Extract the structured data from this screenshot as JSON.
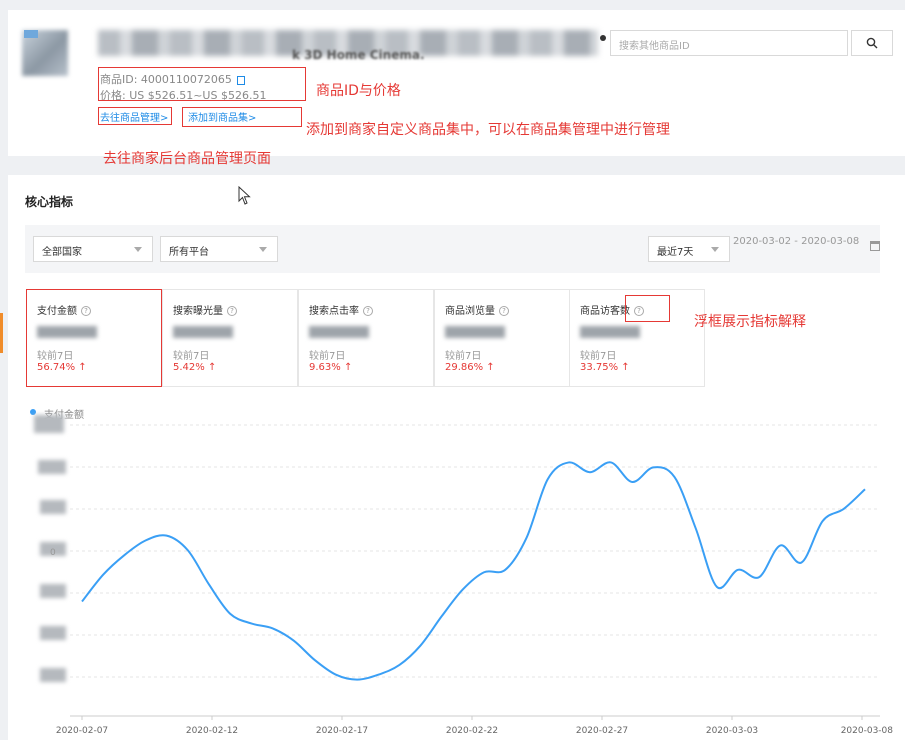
{
  "product": {
    "title_tail": "k 3D Home Cinema.",
    "id_label": "商品ID: 4000110072065",
    "price_label": "价格: US $526.51~US $526.51",
    "goto_manage_link": "去往商品管理>",
    "add_to_collection_link": "添加到商品集>"
  },
  "search": {
    "placeholder": "搜索其他商品ID",
    "icon": "search-icon"
  },
  "annotations": {
    "id_price": "商品ID与价格",
    "add_collection": "添加到商家自定义商品集中，可以在商品集管理中进行管理",
    "goto_backend": "去往商家后台商品管理页面",
    "tooltip_explain": "浮框展示指标解释"
  },
  "core": {
    "section_title": "核心指标",
    "country_select": "全部国家",
    "platform_select": "所有平台",
    "period_select": "最近7天",
    "date_range": "2020-03-02 - 2020-03-08"
  },
  "cards": [
    {
      "title": "支付金额",
      "compare": "较前7日",
      "pct": "56.74% ↑"
    },
    {
      "title": "搜索曝光量",
      "compare": "较前7日",
      "pct": "5.42% ↑"
    },
    {
      "title": "搜索点击率",
      "compare": "较前7日",
      "pct": "9.63% ↑"
    },
    {
      "title": "商品浏览量",
      "compare": "较前7日",
      "pct": "29.86% ↑"
    },
    {
      "title": "商品访客数",
      "compare": "较前7日",
      "pct": "33.75% ↑"
    }
  ],
  "colors": {
    "accent": "#1e8be6",
    "line": "#3a9ff5",
    "annotation": "#e53935",
    "warn": "#f08c2a"
  },
  "chart_data": {
    "type": "line",
    "series": [
      {
        "name": "支付金额",
        "values": [
          0.42,
          0.53,
          0.61,
          0.67,
          0.69,
          0.63,
          0.49,
          0.37,
          0.33,
          0.31,
          0.26,
          0.18,
          0.12,
          0.1,
          0.12,
          0.16,
          0.24,
          0.36,
          0.47,
          0.54,
          0.55,
          0.68,
          0.92,
          0.99,
          0.95,
          0.99,
          0.91,
          0.97,
          0.93,
          0.72,
          0.48,
          0.55,
          0.52,
          0.65,
          0.58,
          0.75,
          0.8,
          0.88
        ]
      }
    ],
    "x_tick_labels": [
      "2020-02-07",
      "2020-02-12",
      "2020-02-17",
      "2020-02-22",
      "2020-02-27",
      "2020-03-03",
      "2020-03-08"
    ],
    "y_tick_labels": [
      "",
      "",
      "",
      "0",
      "",
      "",
      ""
    ],
    "grid": true,
    "legend": "top-left"
  }
}
